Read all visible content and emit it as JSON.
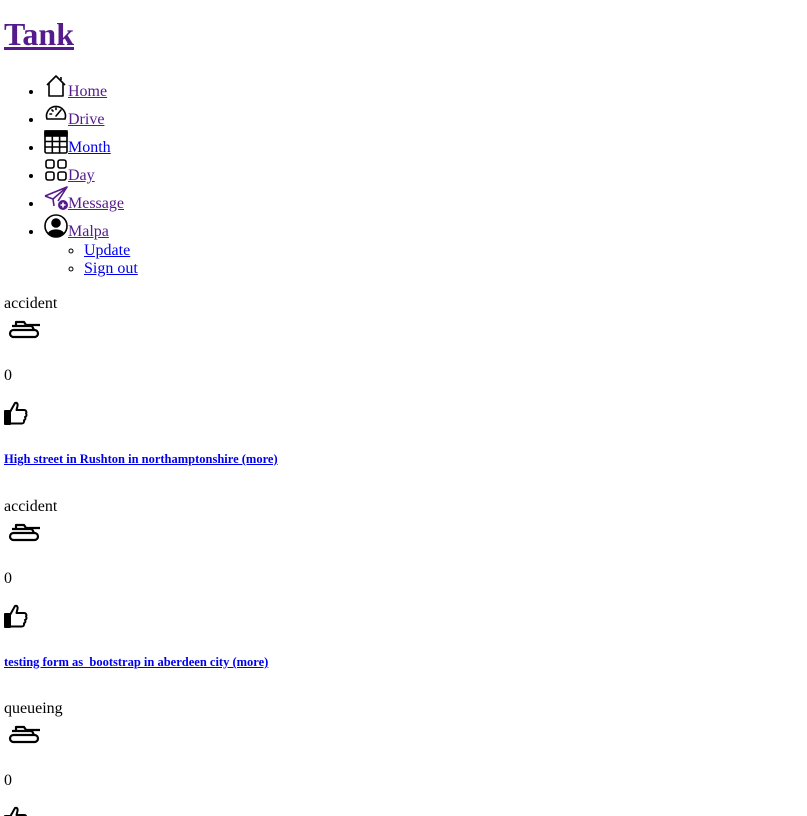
{
  "site": {
    "title": "Tank"
  },
  "nav": {
    "items": [
      {
        "label": "Home",
        "icon": "house-icon"
      },
      {
        "label": "Drive",
        "icon": "speedometer-icon"
      },
      {
        "label": "Month",
        "icon": "calendar-grid-icon"
      },
      {
        "label": "Day",
        "icon": "grid-four-icon"
      },
      {
        "label": "Message",
        "icon": "send-plus-icon"
      },
      {
        "label": "Malpa",
        "icon": "person-circle-icon"
      }
    ],
    "user_menu": [
      {
        "label": "Update"
      },
      {
        "label": "Sign out"
      }
    ]
  },
  "entries": [
    {
      "type": "accident",
      "count": "0",
      "link": "High street in Rushton in northamptonshire (more)"
    },
    {
      "type": "accident",
      "count": "0",
      "link": "testing form as_bootstrap in aberdeen city (more)"
    },
    {
      "type": "queueing",
      "count": "0"
    }
  ],
  "colors": {
    "link": "#0000ee",
    "visited": "#551a8b"
  }
}
